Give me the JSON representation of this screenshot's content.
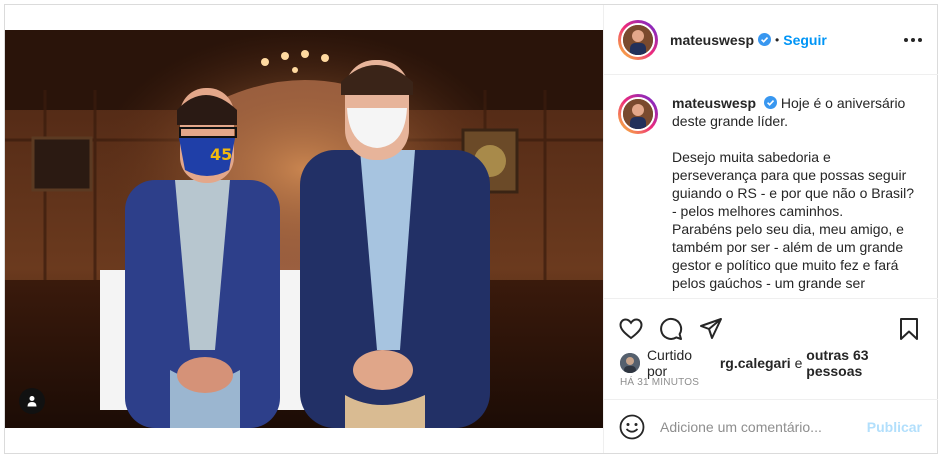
{
  "post": {
    "username": "mateuswesp",
    "separator": "•",
    "follow_label": "Seguir",
    "caption_lines": [
      "Hoje é o aniversário",
      "deste grande líder."
    ],
    "caption_paragraph": [
      "Desejo muita sabedoria e",
      "perseverança para que possas seguir",
      "guiando o RS - e por que não o Brasil?",
      "- pelos melhores caminhos.",
      "Parabéns pelo seu dia, meu amigo, e",
      "também por ser - além de um grande",
      "gestor e político que muito fez e fará",
      "pelos gaúchos - um grande ser"
    ],
    "liked_by_prefix": "Curtido por",
    "liked_by_user": "rg.calegari",
    "liked_by_joiner": "e",
    "liked_by_others": "outras 63 pessoas",
    "timestamp": "HÁ 31 MINUTOS",
    "add_comment_placeholder": "Adicione um comentário...",
    "publish_label": "Publicar"
  },
  "icons": {
    "verified": "verified-badge-icon",
    "more": "more-options-icon",
    "like": "heart-icon",
    "comment": "comment-bubble-icon",
    "share": "paper-plane-icon",
    "save": "bookmark-icon",
    "emoji": "smiley-icon",
    "tag": "user-tag-icon"
  },
  "colors": {
    "accent": "#0095f6",
    "publish_disabled": "#b2dffc",
    "muted": "#8e8e8e",
    "text": "#262626",
    "verified": "#3897f0"
  }
}
